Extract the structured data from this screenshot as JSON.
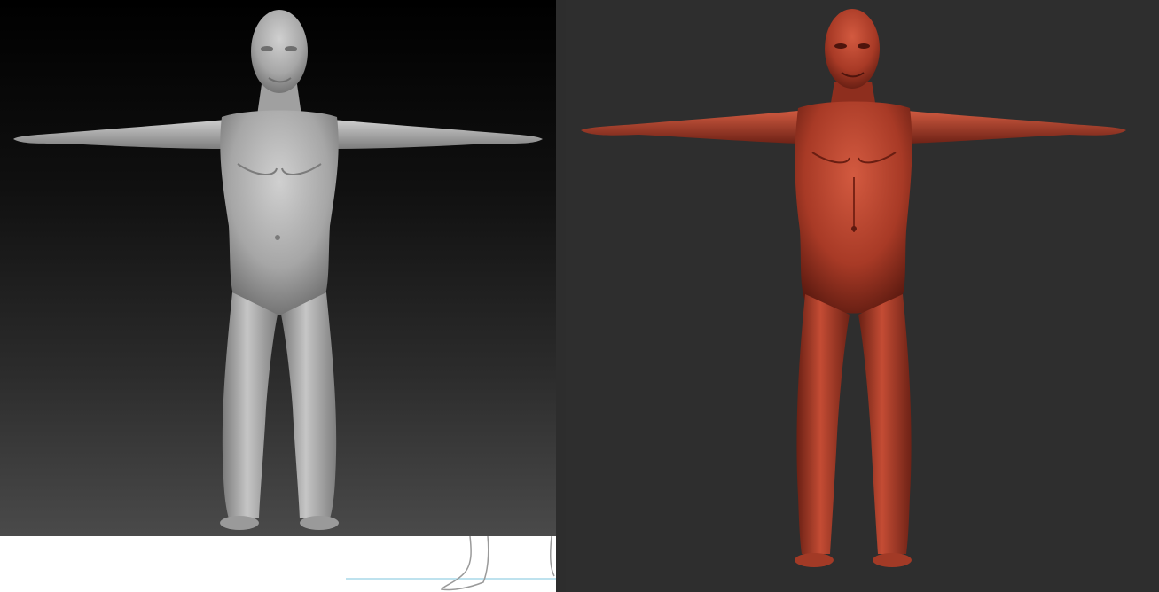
{
  "scene": {
    "left_render": {
      "material": "gray-matcap",
      "background": "black-to-gray-gradient",
      "body_color": "#a9a9a9",
      "shadow_color": "#5e5e5e",
      "highlight_color": "#d4d4d4"
    },
    "right_render": {
      "material": "red-wax",
      "background": "#2e2e2e",
      "body_color": "#b2402c",
      "shadow_color": "#5a1a10",
      "highlight_color": "#d96a52"
    },
    "sketch": {
      "line_color": "#9a9a9a",
      "guide_color": "#a8d8e8"
    }
  }
}
